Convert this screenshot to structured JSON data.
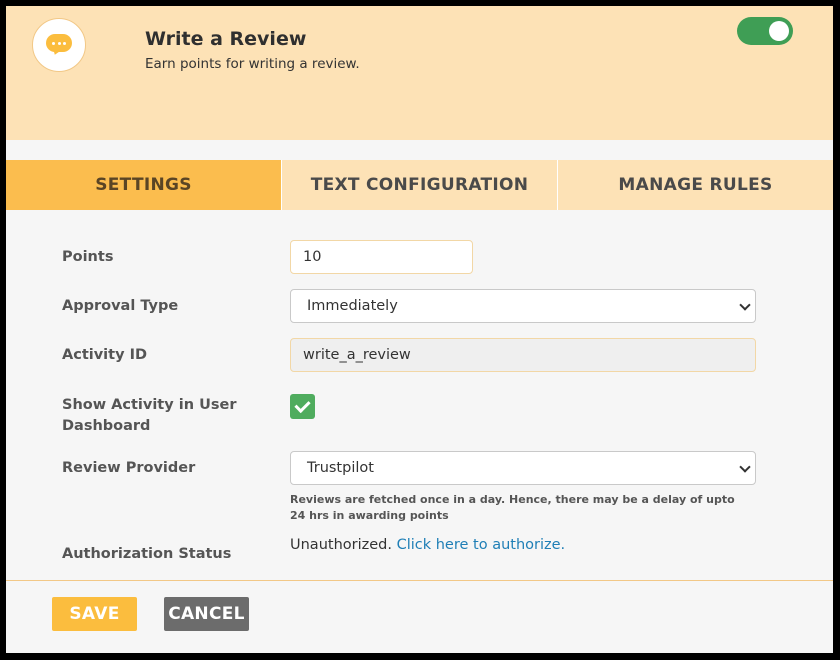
{
  "header": {
    "title": "Write a Review",
    "subtitle": "Earn points for writing a review.",
    "enabled": true,
    "logo_icon": "chat-bubble-dots-icon"
  },
  "tabs": [
    {
      "label": "SETTINGS",
      "active": true
    },
    {
      "label": "TEXT CONFIGURATION",
      "active": false
    },
    {
      "label": "MANAGE RULES",
      "active": false
    }
  ],
  "form": {
    "points": {
      "label": "Points",
      "value": "10"
    },
    "approval_type": {
      "label": "Approval Type",
      "value": "Immediately"
    },
    "activity_id": {
      "label": "Activity ID",
      "value": "write_a_review"
    },
    "show_activity": {
      "label": "Show Activity in User Dashboard",
      "checked": true
    },
    "review_provider": {
      "label": "Review Provider",
      "value": "Trustpilot",
      "hint": "Reviews are fetched once in a day. Hence, there may be a delay of upto 24 hrs in awarding points"
    },
    "authorization": {
      "label": "Authorization Status",
      "status": "Unauthorized.",
      "link": "Click here to authorize."
    }
  },
  "footer": {
    "save_label": "SAVE",
    "cancel_label": "CANCEL"
  },
  "colors": {
    "header_bg": "#fde2b6",
    "accent": "#fbbd3e",
    "toggle_on": "#3f9e55",
    "checkbox": "#4fac5e",
    "link": "#1f7fb6",
    "cancel_bg": "#6c6c6c"
  }
}
